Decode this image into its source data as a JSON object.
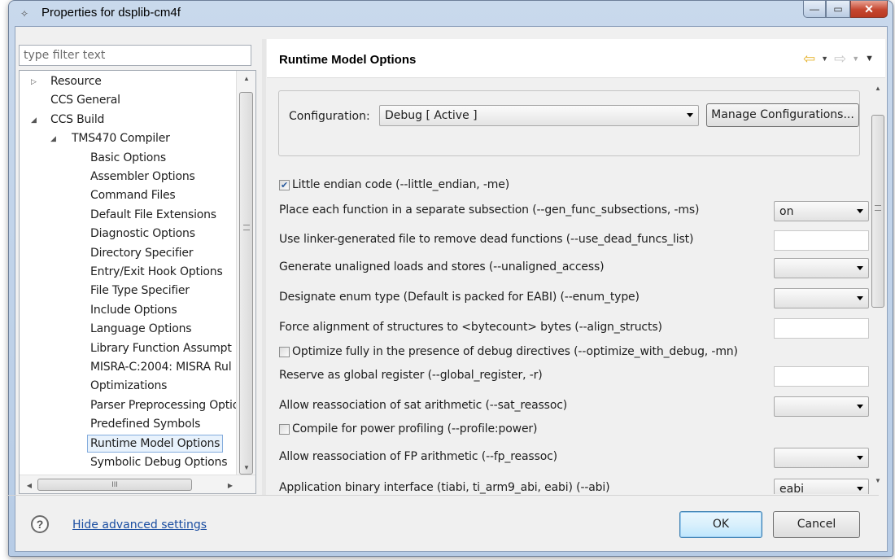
{
  "window": {
    "title": "Properties for dsplib-cm4f",
    "controls": {
      "minimize": "—",
      "maximize": "▭",
      "close": "✕"
    }
  },
  "filter": {
    "placeholder": "type filter text"
  },
  "tree": {
    "items": [
      {
        "label": "Resource",
        "twisty": "▷"
      },
      {
        "label": "CCS General",
        "twisty": ""
      },
      {
        "label": "CCS Build",
        "twisty": "◢"
      },
      {
        "label": "TMS470 Compiler",
        "twisty": "◢"
      },
      {
        "label": "Basic Options"
      },
      {
        "label": "Assembler Options"
      },
      {
        "label": "Command Files"
      },
      {
        "label": "Default File Extensions"
      },
      {
        "label": "Diagnostic Options"
      },
      {
        "label": "Directory Specifier"
      },
      {
        "label": "Entry/Exit Hook Options"
      },
      {
        "label": "File Type Specifier"
      },
      {
        "label": "Include Options"
      },
      {
        "label": "Language Options"
      },
      {
        "label": "Library Function Assumpt"
      },
      {
        "label": "MISRA-C:2004: MISRA Rul"
      },
      {
        "label": "Optimizations"
      },
      {
        "label": "Parser Preprocessing Optio"
      },
      {
        "label": "Predefined Symbols"
      },
      {
        "label": "Runtime Model Options",
        "selected": true
      },
      {
        "label": "Symbolic Debug Options"
      }
    ],
    "hscroll_thumb_glyph": "III"
  },
  "page": {
    "title": "Runtime Model Options",
    "nav": {
      "back": "⇦",
      "forward": "⇨",
      "menu": "▼"
    }
  },
  "configuration": {
    "label": "Configuration:",
    "value": "Debug  [ Active ]",
    "manage_button": "Manage Configurations..."
  },
  "options": [
    {
      "kind": "checkbox",
      "label": "Little endian code (--little_endian, -me)",
      "checked": true
    },
    {
      "kind": "select",
      "label": "Place each function in a separate subsection (--gen_func_subsections, -ms)",
      "value": "on"
    },
    {
      "kind": "text",
      "label": "Use linker-generated file to remove dead functions (--use_dead_funcs_list)",
      "value": ""
    },
    {
      "kind": "select",
      "label": "Generate unaligned loads and stores (--unaligned_access)",
      "value": ""
    },
    {
      "kind": "select",
      "label": "Designate enum type (Default is packed for EABI) (--enum_type)",
      "value": ""
    },
    {
      "kind": "text",
      "label": "Force alignment of structures to <bytecount> bytes (--align_structs)",
      "value": ""
    },
    {
      "kind": "checkbox",
      "label": "Optimize fully in the presence of debug directives (--optimize_with_debug, -mn)",
      "checked": false
    },
    {
      "kind": "text",
      "label": "Reserve as global register (--global_register, -r)",
      "value": ""
    },
    {
      "kind": "select",
      "label": "Allow reassociation of sat arithmetic (--sat_reassoc)",
      "value": ""
    },
    {
      "kind": "checkbox",
      "label": "Compile for power profiling (--profile:power)",
      "checked": false
    },
    {
      "kind": "select",
      "label": "Allow reassociation of FP arithmetic (--fp_reassoc)",
      "value": ""
    },
    {
      "kind": "select",
      "label": "Application binary interface (tiabi, ti_arm9_abi, eabi) (--abi)",
      "value": "eabi"
    }
  ],
  "footer": {
    "help_glyph": "?",
    "hide_link": "Hide advanced settings",
    "ok": "OK",
    "cancel": "Cancel"
  }
}
